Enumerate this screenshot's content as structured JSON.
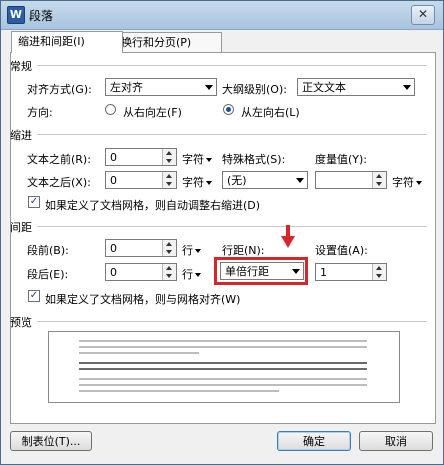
{
  "window": {
    "title": "段落",
    "app_icon": "W",
    "close_label": "✕"
  },
  "tabs": [
    {
      "label": "缩进和间距(I)",
      "active": true
    },
    {
      "label": "换行和分页(P)",
      "active": false
    }
  ],
  "general": {
    "heading": "常规",
    "alignment_label": "对齐方式(G):",
    "alignment_value": "左对齐",
    "outline_label": "大纲级别(O):",
    "outline_value": "正文文本",
    "direction_label": "方向:",
    "rtl_label": "从右向左(F)",
    "ltr_label": "从左向右(L)"
  },
  "indent": {
    "heading": "缩进",
    "before_label": "文本之前(R):",
    "before_value": "0",
    "before_unit": "字符",
    "special_label": "特殊格式(S):",
    "special_value": "(无)",
    "measure_label": "度量值(Y):",
    "measure_value": "",
    "measure_unit": "字符",
    "after_label": "文本之后(X):",
    "after_value": "0",
    "after_unit": "字符",
    "auto_adjust_label": "如果定义了文档网格，则自动调整右缩进(D)",
    "auto_adjust_checked": true
  },
  "spacing": {
    "heading": "间距",
    "before_label": "段前(B):",
    "before_value": "0",
    "before_unit": "行",
    "line_label": "行距(N):",
    "line_value": "单倍行距",
    "setting_label": "设置值(A):",
    "setting_value": "1",
    "after_label": "段后(E):",
    "after_value": "0",
    "after_unit": "行",
    "snap_grid_label": "如果定义了文档网格，则与网格对齐(W)",
    "snap_grid_checked": true
  },
  "preview": {
    "heading": "预览"
  },
  "footer": {
    "tabs_button": "制表位(T)...",
    "ok_button": "确定",
    "cancel_button": "取消"
  },
  "annotation": {
    "highlight_color": "#d6262a"
  }
}
